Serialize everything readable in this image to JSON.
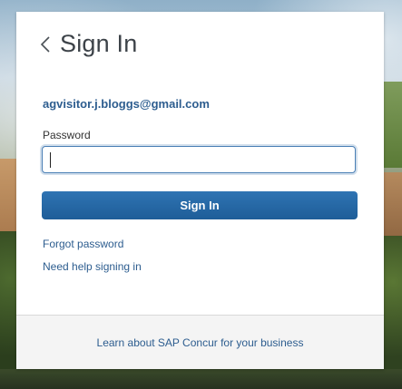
{
  "header": {
    "back_icon": "chevron-left-icon",
    "title": "Sign In"
  },
  "account": {
    "email": "agvisitor.j.bloggs@gmail.com"
  },
  "password": {
    "label": "Password",
    "value": "",
    "placeholder": ""
  },
  "actions": {
    "signin_label": "Sign In",
    "forgot_password": "Forgot password",
    "need_help": "Need help signing in"
  },
  "footer": {
    "learn_more": "Learn about SAP Concur for your business"
  },
  "colors": {
    "accent": "#1e5d98",
    "link": "#2d5d8f",
    "background_card": "#ffffff",
    "footer_bg": "#f4f4f4"
  }
}
